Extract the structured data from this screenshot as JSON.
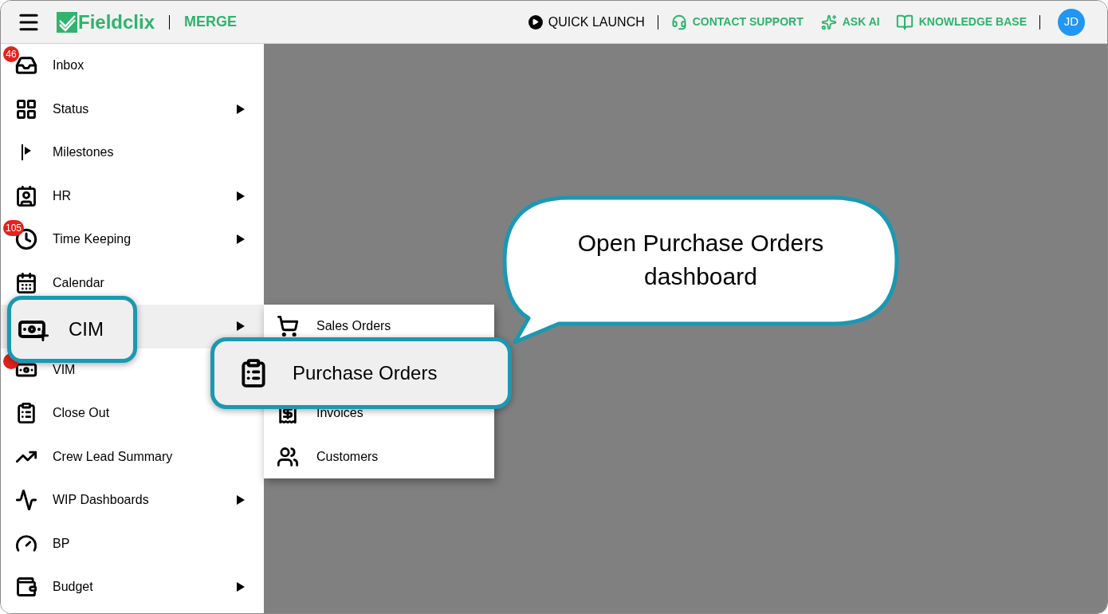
{
  "header": {
    "app_name": "Fieldclix",
    "module": "MERGE",
    "avatar": "JD",
    "links": [
      {
        "label": "QUICK LAUNCH",
        "kind": "plain"
      },
      {
        "label": "CONTACT SUPPORT",
        "kind": "accent"
      },
      {
        "label": "ASK AI",
        "kind": "accent"
      },
      {
        "label": "KNOWLEDGE BASE",
        "kind": "accent"
      }
    ]
  },
  "sidebar": {
    "items": [
      {
        "label": "Inbox",
        "badge": "46",
        "has_submenu": false,
        "selected": false,
        "zoomed": false
      },
      {
        "label": "Status",
        "has_submenu": true,
        "selected": false,
        "zoomed": false
      },
      {
        "label": "Milestones",
        "has_submenu": false,
        "selected": false,
        "zoomed": false
      },
      {
        "label": "HR",
        "has_submenu": true,
        "selected": false,
        "zoomed": false
      },
      {
        "label": "Time Keeping",
        "badge": "105",
        "has_submenu": true,
        "selected": false,
        "zoomed": false
      },
      {
        "label": "Calendar",
        "has_submenu": false,
        "selected": false,
        "zoomed": false
      },
      {
        "label": "CIM",
        "has_submenu": true,
        "selected": true,
        "zoomed": true
      },
      {
        "label": "VIM",
        "badge_hidden": true,
        "has_submenu": false,
        "selected": false,
        "zoomed": false
      },
      {
        "label": "Close Out",
        "has_submenu": false,
        "selected": false,
        "zoomed": false
      },
      {
        "label": "Crew Lead Summary",
        "has_submenu": false,
        "selected": false,
        "zoomed": false
      },
      {
        "label": "WIP Dashboards",
        "has_submenu": true,
        "selected": false,
        "zoomed": false
      },
      {
        "label": "BP",
        "has_submenu": false,
        "selected": false,
        "zoomed": false
      },
      {
        "label": "Budget",
        "has_submenu": true,
        "selected": false,
        "zoomed": false
      }
    ]
  },
  "submenu": {
    "items": [
      {
        "label": "Sales Orders",
        "selected": false,
        "zoomed": false
      },
      {
        "label": "Purchase Orders",
        "selected": true,
        "zoomed": true
      },
      {
        "label": "Invoices",
        "selected": false,
        "zoomed": false
      },
      {
        "label": "Customers",
        "selected": false,
        "zoomed": false
      }
    ]
  },
  "callout": {
    "text": "Open Purchase Orders dashboard"
  }
}
